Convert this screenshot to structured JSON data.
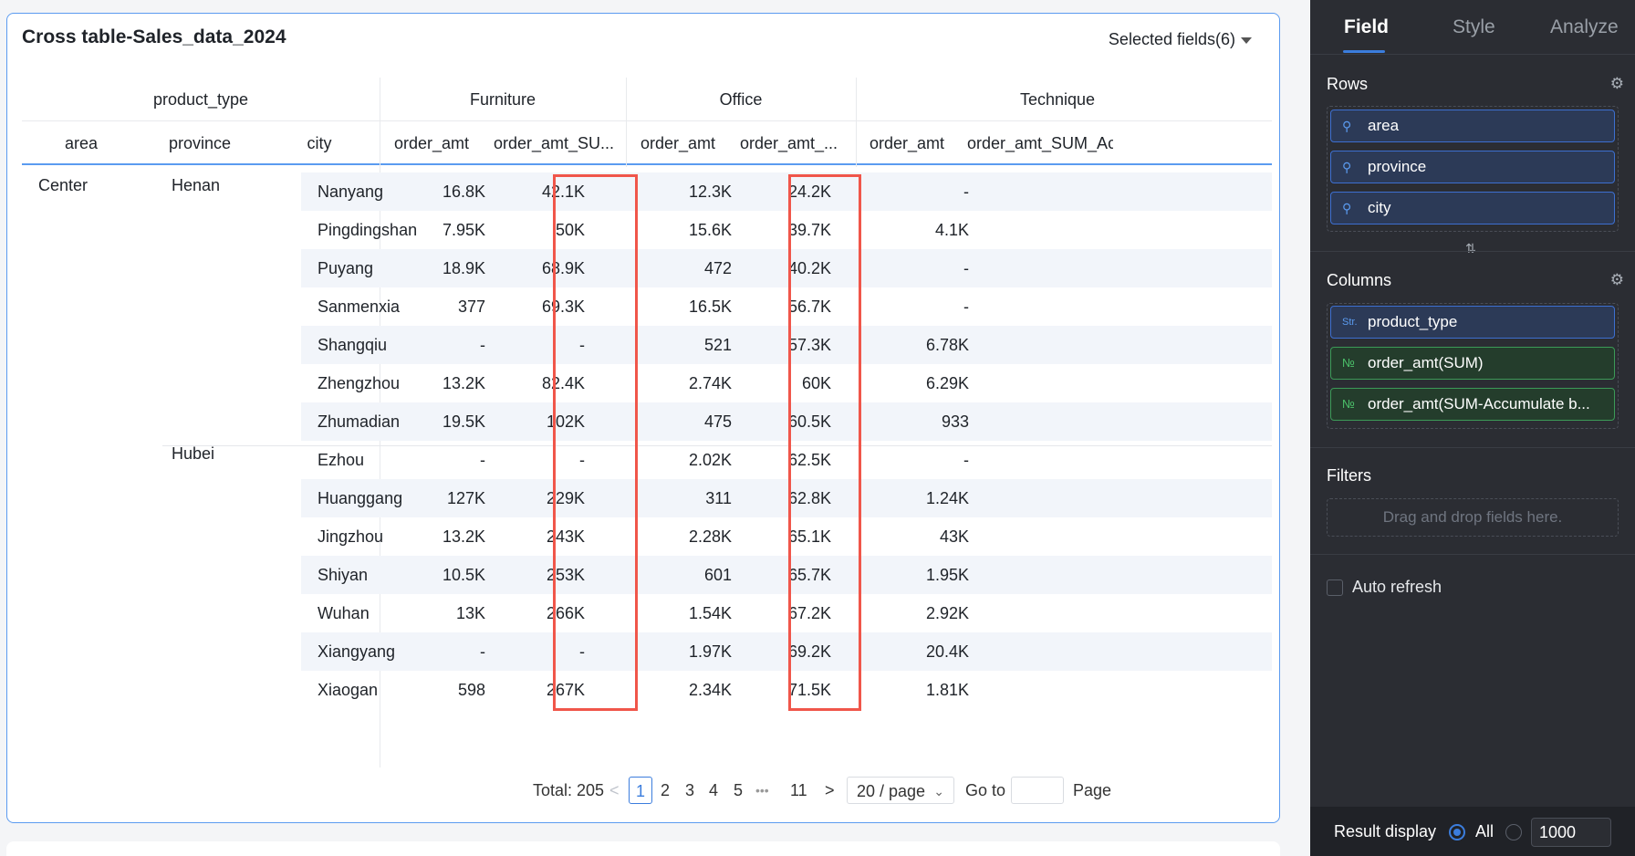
{
  "card": {
    "title": "Cross table-Sales_data_2024",
    "selected_fields": "Selected fields(6)"
  },
  "table": {
    "header_row1": {
      "row_dim_label": "product_type",
      "groups": [
        "Furniture",
        "Office",
        "Technique"
      ]
    },
    "header_row2": [
      "area",
      "province",
      "city",
      "order_amt",
      "order_amt_SU...",
      "order_amt",
      "order_amt_...",
      "order_amt",
      "order_amt_SUM_Acc"
    ],
    "area": "Center",
    "provinces": [
      {
        "name": "Henan",
        "rows": [
          {
            "city": "Nanyang",
            "values": [
              "16.8K",
              "42.1K",
              "12.3K",
              "24.2K",
              "-"
            ]
          },
          {
            "city": "Pingdingshan",
            "values": [
              "7.95K",
              "50K",
              "15.6K",
              "39.7K",
              "4.1K"
            ]
          },
          {
            "city": "Puyang",
            "values": [
              "18.9K",
              "68.9K",
              "472",
              "40.2K",
              "-"
            ]
          },
          {
            "city": "Sanmenxia",
            "values": [
              "377",
              "69.3K",
              "16.5K",
              "56.7K",
              "-"
            ]
          },
          {
            "city": "Shangqiu",
            "values": [
              "-",
              "-",
              "521",
              "57.3K",
              "6.78K"
            ]
          },
          {
            "city": "Zhengzhou",
            "values": [
              "13.2K",
              "82.4K",
              "2.74K",
              "60K",
              "6.29K"
            ]
          },
          {
            "city": "Zhumadian",
            "values": [
              "19.5K",
              "102K",
              "475",
              "60.5K",
              "933"
            ]
          }
        ]
      },
      {
        "name": "Hubei",
        "rows": [
          {
            "city": "Ezhou",
            "values": [
              "-",
              "-",
              "2.02K",
              "62.5K",
              "-"
            ]
          },
          {
            "city": "Huanggang",
            "values": [
              "127K",
              "229K",
              "311",
              "62.8K",
              "1.24K"
            ]
          },
          {
            "city": "Jingzhou",
            "values": [
              "13.2K",
              "243K",
              "2.28K",
              "65.1K",
              "43K"
            ]
          },
          {
            "city": "Shiyan",
            "values": [
              "10.5K",
              "253K",
              "601",
              "65.7K",
              "1.95K"
            ]
          },
          {
            "city": "Wuhan",
            "values": [
              "13K",
              "266K",
              "1.54K",
              "67.2K",
              "2.92K"
            ]
          },
          {
            "city": "Xiangyang",
            "values": [
              "-",
              "-",
              "1.97K",
              "69.2K",
              "20.4K"
            ]
          },
          {
            "city": "Xiaogan",
            "values": [
              "598",
              "267K",
              "2.34K",
              "71.5K",
              "1.81K"
            ]
          }
        ]
      }
    ]
  },
  "pagination": {
    "total": "Total: 205",
    "prev": "<",
    "pages": [
      "1",
      "2",
      "3",
      "4",
      "5",
      "•••",
      "11"
    ],
    "next": ">",
    "page_size": "20 / page",
    "goto": "Go to",
    "page_word": "Page"
  },
  "panel": {
    "tabs": [
      "Field",
      "Style",
      "Analyze"
    ],
    "rows_title": "Rows",
    "rows": [
      "area",
      "province",
      "city"
    ],
    "columns_title": "Columns",
    "columns": [
      {
        "icon": "Str.",
        "label": "product_type"
      },
      {
        "icon": "№",
        "label": "order_amt(SUM)"
      },
      {
        "icon": "№",
        "label": "order_amt(SUM-Accumulate b..."
      }
    ],
    "filters_title": "Filters",
    "filters_placeholder": "Drag and drop fields here.",
    "auto_refresh": "Auto refresh",
    "result_display": "Result display",
    "result_all": "All",
    "result_limit": "1000"
  },
  "colors": {
    "accent": "#3b7ddd",
    "highlight_box": "#f0564a",
    "panel_bg": "#2b2d33",
    "stripe": "#f2f5fa"
  }
}
